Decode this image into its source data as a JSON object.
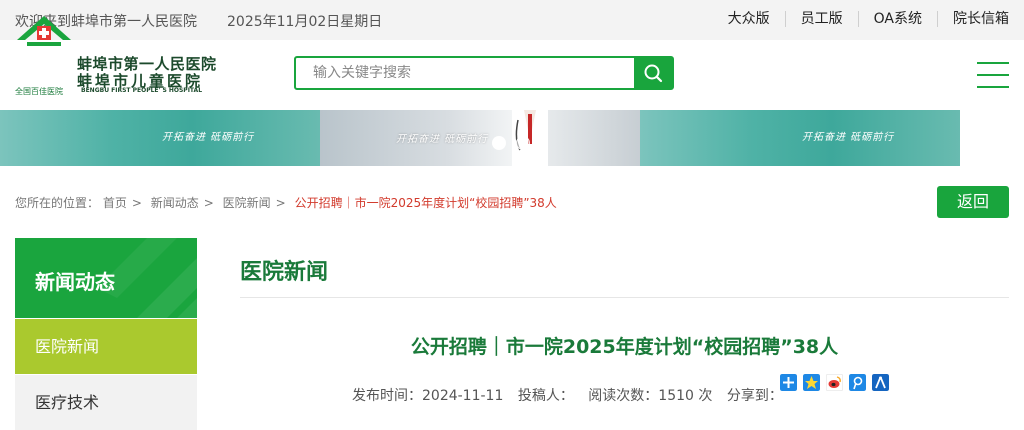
{
  "topbar": {
    "welcome": "欢迎来到蚌埠市第一人民医院",
    "date": "2025年11月02日星期日",
    "links": [
      "大众版",
      "员工版",
      "OA系统",
      "院长信箱"
    ]
  },
  "logo": {
    "name_line1": "蚌埠市第一人民医院",
    "name_line2": "蚌埠市儿童医院",
    "name_en": "BENGBU FIRST PEOPLE' S HOSPITAL",
    "tagline": "全国百佳医院"
  },
  "search": {
    "placeholder": "输入关键字搜索",
    "icon": "search-icon"
  },
  "banner": {
    "slogan": "开拓奋进 砥砺前行",
    "active_dot": 1,
    "dot_count": 2
  },
  "breadcrumb": {
    "prefix": "您所在的位置：",
    "items": [
      "首页",
      "新闻动态",
      "医院新闻"
    ],
    "current": "公开招聘｜市一院2025年度计划“校园招聘”38人"
  },
  "back_label": "返回",
  "sidebar": {
    "heading": "新闻动态",
    "items": [
      "医院新闻",
      "医疗技术"
    ]
  },
  "content": {
    "section_title": "医院新闻",
    "article_title": "公开招聘｜市一院2025年度计划“校园招聘”38人",
    "meta": {
      "published": "发布时间：2024-11-11",
      "author": "投稿人：",
      "views": "阅读次数：1510 次",
      "share_label": "分享到："
    },
    "share_icons": [
      "share-more-icon",
      "qzone-icon",
      "weibo-icon",
      "tencent-weibo-icon",
      "renren-icon"
    ]
  },
  "colors": {
    "brand_green": "#19a53d",
    "sidebar_active": "#aac92e",
    "breadcrumb_current": "#d23a2c",
    "title_green": "#1a7a3a"
  }
}
